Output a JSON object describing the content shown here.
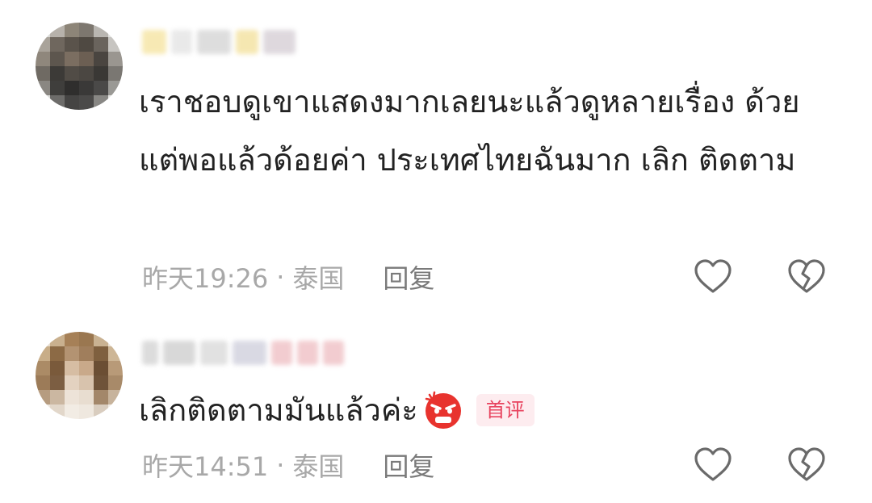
{
  "comments": [
    {
      "text": "เราชอบดูเขาแสดงมากเลยนะแล้วดูหลายเรื่อง ด้วย แต่พอแล้วด้อยค่า ประเทศไทยฉันมาก เลิก ติดตาม",
      "time": "昨天19:26",
      "separator": "·",
      "location": "泰国",
      "reply_label": "回复"
    },
    {
      "text": "เลิกติดตามมันแล้วค่ะ",
      "emoji": "angry-face-icon",
      "tag": "首评",
      "time": "昨天14:51",
      "separator": "·",
      "location": "泰国",
      "reply_label": "回复"
    }
  ],
  "colors": {
    "text": "#222222",
    "meta": "#a8a8a8",
    "reply": "#7a7a7a",
    "tag_text": "#e8445f",
    "tag_bg": "#fdecef",
    "icon": "#6a6a6a"
  }
}
